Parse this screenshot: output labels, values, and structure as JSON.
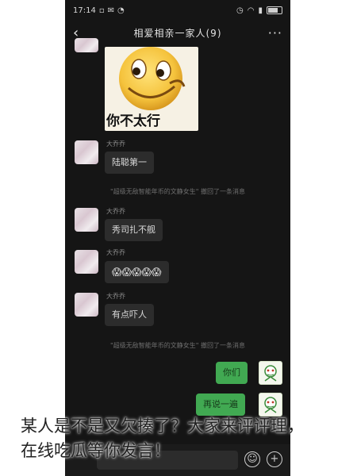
{
  "status": {
    "time": "17:14"
  },
  "header": {
    "back_icon": "back-chevron",
    "title": "相爱相亲一家人(9)",
    "more_icon": "more-dots"
  },
  "sticker": {
    "label": "你不太行"
  },
  "messages": [
    {
      "sender": "大乔乔",
      "text": "陆聪第一"
    },
    {
      "sender": "大乔乔",
      "text": "秀司扎不舰"
    },
    {
      "sender": "大乔乔",
      "text": "😱😱😱😱😱"
    },
    {
      "sender": "大乔乔",
      "text": "有点吓人"
    }
  ],
  "notices": [
    "\"超级无敌智能年币的文静女生\" 撤回了一条消息",
    "\"超级无敌智能年币的文静女生\" 撤回了一条消息"
  ],
  "my_messages": [
    {
      "text": "你们"
    },
    {
      "text": "再说一遍"
    }
  ],
  "input_bar": {
    "emoji_icon": "emoji-icon",
    "plus_icon": "plus-icon"
  },
  "caption": {
    "line1": "某人是不是又欠揍了？大家来评评理，",
    "line2": "在线吃瓜等你发言！"
  }
}
